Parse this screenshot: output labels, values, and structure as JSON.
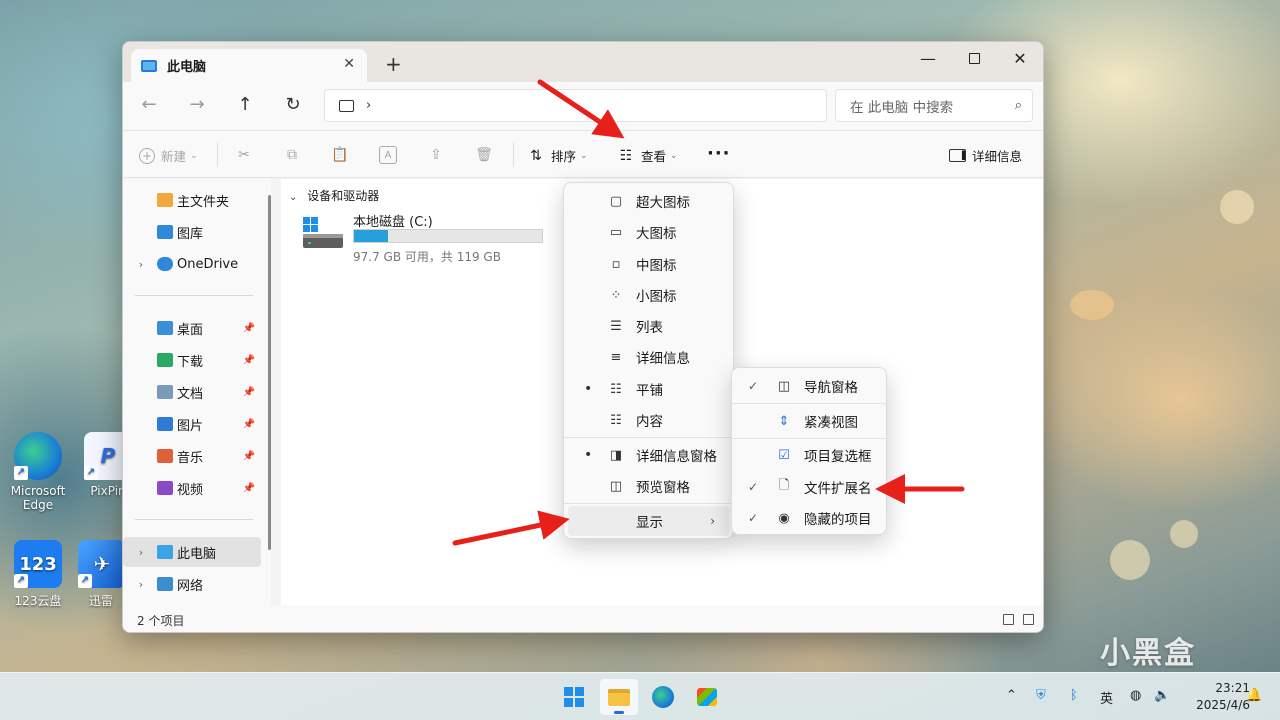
{
  "desktop": {
    "icons": [
      {
        "label": "Microsoft Edge"
      },
      {
        "label": "PixPin"
      },
      {
        "label": "123云盘"
      },
      {
        "label": "迅雷"
      }
    ]
  },
  "window": {
    "tab_title": "此电脑",
    "search_placeholder": "在 此电脑 中搜索",
    "toolbar": {
      "new_label": "新建",
      "sort_label": "排序",
      "view_label": "查看",
      "details_label": "详细信息"
    },
    "sidebar": {
      "items": [
        {
          "label": "主文件夹"
        },
        {
          "label": "图库"
        },
        {
          "label": "OneDrive"
        },
        {
          "label": "桌面"
        },
        {
          "label": "下载"
        },
        {
          "label": "文档"
        },
        {
          "label": "图片"
        },
        {
          "label": "音乐"
        },
        {
          "label": "视频"
        },
        {
          "label": "此电脑"
        },
        {
          "label": "网络"
        }
      ]
    },
    "content": {
      "group_header": "设备和驱动器",
      "drive": {
        "name": "本地磁盘 (C:)",
        "free_text": "97.7 GB 可用，共 119 GB",
        "used_fraction": 0.18
      }
    },
    "status": {
      "item_count": "2 个项目"
    }
  },
  "view_menu": {
    "items": [
      {
        "label": "超大图标"
      },
      {
        "label": "大图标"
      },
      {
        "label": "中图标"
      },
      {
        "label": "小图标"
      },
      {
        "label": "列表"
      },
      {
        "label": "详细信息"
      },
      {
        "label": "平铺"
      },
      {
        "label": "内容"
      },
      {
        "label": "详细信息窗格"
      },
      {
        "label": "预览窗格"
      },
      {
        "label": "显示"
      }
    ]
  },
  "show_submenu": {
    "items": [
      {
        "label": "导航窗格"
      },
      {
        "label": "紧凑视图"
      },
      {
        "label": "项目复选框"
      },
      {
        "label": "文件扩展名"
      },
      {
        "label": "隐藏的项目"
      }
    ]
  },
  "taskbar": {
    "ime": "英",
    "time": "23:21",
    "date": "2025/4/6"
  },
  "watermark": "小黑盒",
  "colors": {
    "accent": "#1f6fd6",
    "drive_fill": "#26a0da",
    "annotation_arrow": "#e8201a"
  }
}
